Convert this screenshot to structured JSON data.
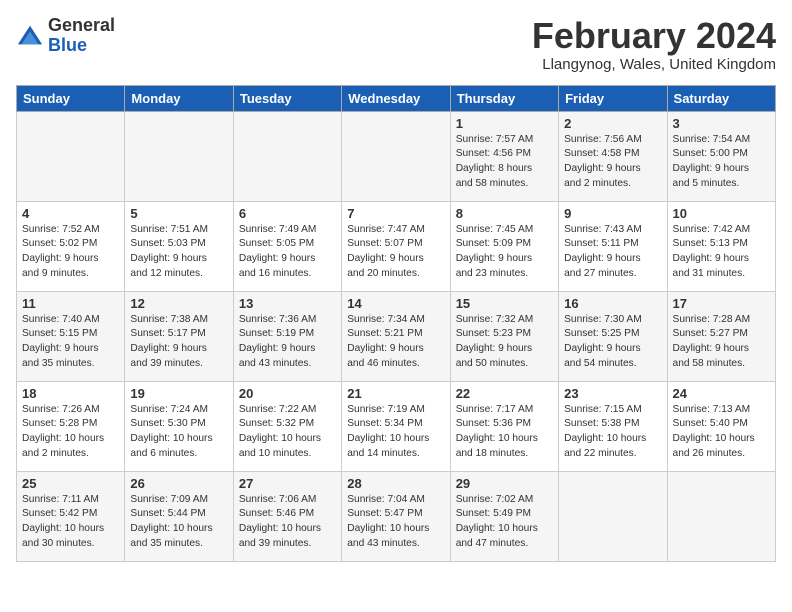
{
  "header": {
    "logo_general": "General",
    "logo_blue": "Blue",
    "month_year": "February 2024",
    "location": "Llangynog, Wales, United Kingdom"
  },
  "days_of_week": [
    "Sunday",
    "Monday",
    "Tuesday",
    "Wednesday",
    "Thursday",
    "Friday",
    "Saturday"
  ],
  "weeks": [
    [
      {
        "day": "",
        "info": ""
      },
      {
        "day": "",
        "info": ""
      },
      {
        "day": "",
        "info": ""
      },
      {
        "day": "",
        "info": ""
      },
      {
        "day": "1",
        "info": "Sunrise: 7:57 AM\nSunset: 4:56 PM\nDaylight: 8 hours\nand 58 minutes."
      },
      {
        "day": "2",
        "info": "Sunrise: 7:56 AM\nSunset: 4:58 PM\nDaylight: 9 hours\nand 2 minutes."
      },
      {
        "day": "3",
        "info": "Sunrise: 7:54 AM\nSunset: 5:00 PM\nDaylight: 9 hours\nand 5 minutes."
      }
    ],
    [
      {
        "day": "4",
        "info": "Sunrise: 7:52 AM\nSunset: 5:02 PM\nDaylight: 9 hours\nand 9 minutes."
      },
      {
        "day": "5",
        "info": "Sunrise: 7:51 AM\nSunset: 5:03 PM\nDaylight: 9 hours\nand 12 minutes."
      },
      {
        "day": "6",
        "info": "Sunrise: 7:49 AM\nSunset: 5:05 PM\nDaylight: 9 hours\nand 16 minutes."
      },
      {
        "day": "7",
        "info": "Sunrise: 7:47 AM\nSunset: 5:07 PM\nDaylight: 9 hours\nand 20 minutes."
      },
      {
        "day": "8",
        "info": "Sunrise: 7:45 AM\nSunset: 5:09 PM\nDaylight: 9 hours\nand 23 minutes."
      },
      {
        "day": "9",
        "info": "Sunrise: 7:43 AM\nSunset: 5:11 PM\nDaylight: 9 hours\nand 27 minutes."
      },
      {
        "day": "10",
        "info": "Sunrise: 7:42 AM\nSunset: 5:13 PM\nDaylight: 9 hours\nand 31 minutes."
      }
    ],
    [
      {
        "day": "11",
        "info": "Sunrise: 7:40 AM\nSunset: 5:15 PM\nDaylight: 9 hours\nand 35 minutes."
      },
      {
        "day": "12",
        "info": "Sunrise: 7:38 AM\nSunset: 5:17 PM\nDaylight: 9 hours\nand 39 minutes."
      },
      {
        "day": "13",
        "info": "Sunrise: 7:36 AM\nSunset: 5:19 PM\nDaylight: 9 hours\nand 43 minutes."
      },
      {
        "day": "14",
        "info": "Sunrise: 7:34 AM\nSunset: 5:21 PM\nDaylight: 9 hours\nand 46 minutes."
      },
      {
        "day": "15",
        "info": "Sunrise: 7:32 AM\nSunset: 5:23 PM\nDaylight: 9 hours\nand 50 minutes."
      },
      {
        "day": "16",
        "info": "Sunrise: 7:30 AM\nSunset: 5:25 PM\nDaylight: 9 hours\nand 54 minutes."
      },
      {
        "day": "17",
        "info": "Sunrise: 7:28 AM\nSunset: 5:27 PM\nDaylight: 9 hours\nand 58 minutes."
      }
    ],
    [
      {
        "day": "18",
        "info": "Sunrise: 7:26 AM\nSunset: 5:28 PM\nDaylight: 10 hours\nand 2 minutes."
      },
      {
        "day": "19",
        "info": "Sunrise: 7:24 AM\nSunset: 5:30 PM\nDaylight: 10 hours\nand 6 minutes."
      },
      {
        "day": "20",
        "info": "Sunrise: 7:22 AM\nSunset: 5:32 PM\nDaylight: 10 hours\nand 10 minutes."
      },
      {
        "day": "21",
        "info": "Sunrise: 7:19 AM\nSunset: 5:34 PM\nDaylight: 10 hours\nand 14 minutes."
      },
      {
        "day": "22",
        "info": "Sunrise: 7:17 AM\nSunset: 5:36 PM\nDaylight: 10 hours\nand 18 minutes."
      },
      {
        "day": "23",
        "info": "Sunrise: 7:15 AM\nSunset: 5:38 PM\nDaylight: 10 hours\nand 22 minutes."
      },
      {
        "day": "24",
        "info": "Sunrise: 7:13 AM\nSunset: 5:40 PM\nDaylight: 10 hours\nand 26 minutes."
      }
    ],
    [
      {
        "day": "25",
        "info": "Sunrise: 7:11 AM\nSunset: 5:42 PM\nDaylight: 10 hours\nand 30 minutes."
      },
      {
        "day": "26",
        "info": "Sunrise: 7:09 AM\nSunset: 5:44 PM\nDaylight: 10 hours\nand 35 minutes."
      },
      {
        "day": "27",
        "info": "Sunrise: 7:06 AM\nSunset: 5:46 PM\nDaylight: 10 hours\nand 39 minutes."
      },
      {
        "day": "28",
        "info": "Sunrise: 7:04 AM\nSunset: 5:47 PM\nDaylight: 10 hours\nand 43 minutes."
      },
      {
        "day": "29",
        "info": "Sunrise: 7:02 AM\nSunset: 5:49 PM\nDaylight: 10 hours\nand 47 minutes."
      },
      {
        "day": "",
        "info": ""
      },
      {
        "day": "",
        "info": ""
      }
    ]
  ]
}
